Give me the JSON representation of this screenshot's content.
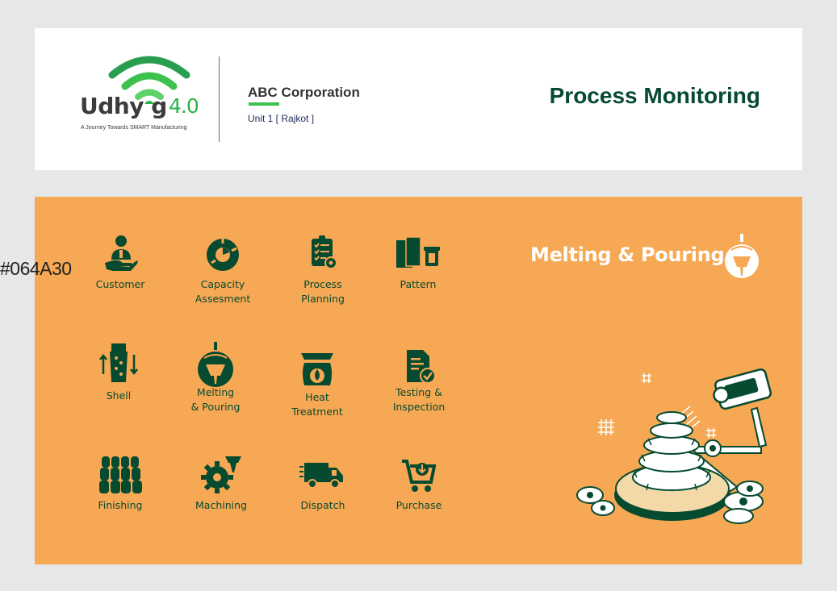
{
  "header": {
    "logo": {
      "word": "Udhy g",
      "version": "4.0",
      "tagline": "A Journey Towards SMART Manufacturing"
    },
    "company": "ABC Corporation",
    "unit": "Unit 1 [ Rajkot ]",
    "page_title": "Process Monitoring"
  },
  "overlay_label": "#064A30",
  "colors": {
    "primary": "#064A30",
    "panel": "#f7a854",
    "accent": "#3cc14c"
  },
  "modules": [
    {
      "label": "Customer",
      "icon": "customer-icon"
    },
    {
      "label": "Capacity\nAssesment",
      "icon": "capacity-icon"
    },
    {
      "label": "Process\nPlanning",
      "icon": "process-planning-icon"
    },
    {
      "label": "Pattern",
      "icon": "pattern-icon"
    },
    {
      "label": "Shell",
      "icon": "shell-icon"
    },
    {
      "label": "Melting\n& Pouring",
      "icon": "ladle-icon"
    },
    {
      "label": "Heat\nTreatment",
      "icon": "furnace-icon"
    },
    {
      "label": "Testing &\nInspection",
      "icon": "document-check-icon"
    },
    {
      "label": "Finishing",
      "icon": "finishing-icon"
    },
    {
      "label": "Machining",
      "icon": "machining-gear-icon"
    },
    {
      "label": "Dispatch",
      "icon": "truck-icon"
    },
    {
      "label": "Purchase",
      "icon": "cart-icon"
    }
  ],
  "selected": {
    "title": "Melting & Pouring",
    "icon": "ladle-icon"
  }
}
